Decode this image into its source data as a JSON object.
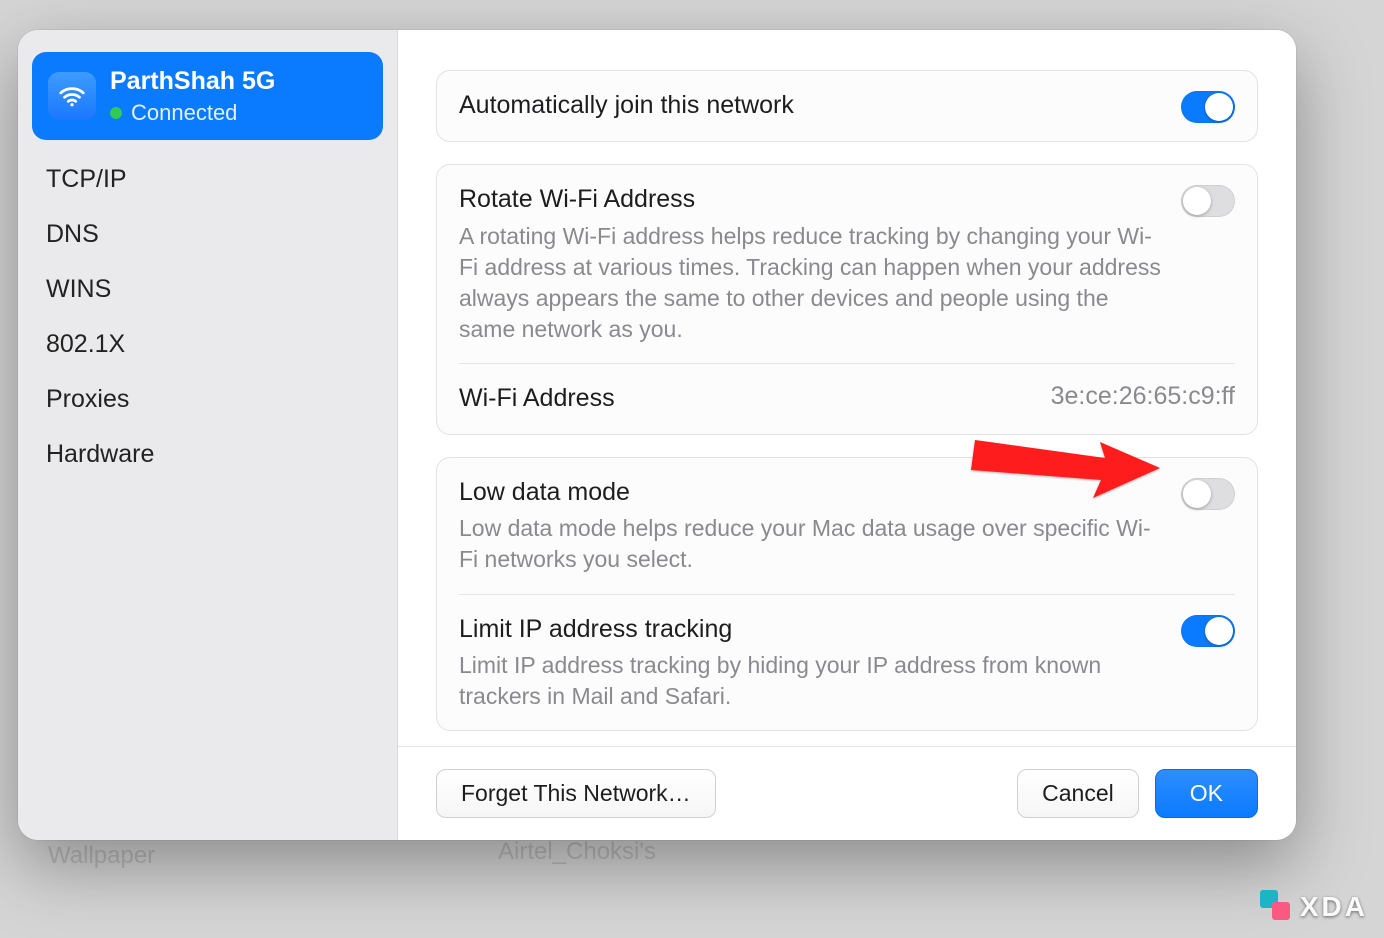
{
  "background": {
    "wallpaper_label": "Wallpaper",
    "other_network": "Airtel_Choksi's"
  },
  "sidebar": {
    "network_name": "ParthShah 5G",
    "status_text": "Connected",
    "items": [
      {
        "label": "TCP/IP"
      },
      {
        "label": "DNS"
      },
      {
        "label": "WINS"
      },
      {
        "label": "802.1X"
      },
      {
        "label": "Proxies"
      },
      {
        "label": "Hardware"
      }
    ]
  },
  "settings": {
    "auto_join": {
      "title": "Automatically join this network",
      "enabled": true
    },
    "rotate_addr": {
      "title": "Rotate Wi-Fi Address",
      "desc": "A rotating Wi-Fi address helps reduce tracking by changing your Wi-Fi address at various times. Tracking can happen when your address always appears the same to other devices and people using the same network as you.",
      "enabled": false
    },
    "wifi_addr": {
      "title": "Wi-Fi Address",
      "value": "3e:ce:26:65:c9:ff"
    },
    "low_data": {
      "title": "Low data mode",
      "desc": "Low data mode helps reduce your Mac data usage over specific Wi-Fi networks you select.",
      "enabled": false
    },
    "limit_ip": {
      "title": "Limit IP address tracking",
      "desc": "Limit IP address tracking by hiding your IP address from known trackers in Mail and Safari.",
      "enabled": true
    }
  },
  "footer": {
    "forget": "Forget This Network…",
    "cancel": "Cancel",
    "ok": "OK"
  },
  "watermark": "XDA"
}
